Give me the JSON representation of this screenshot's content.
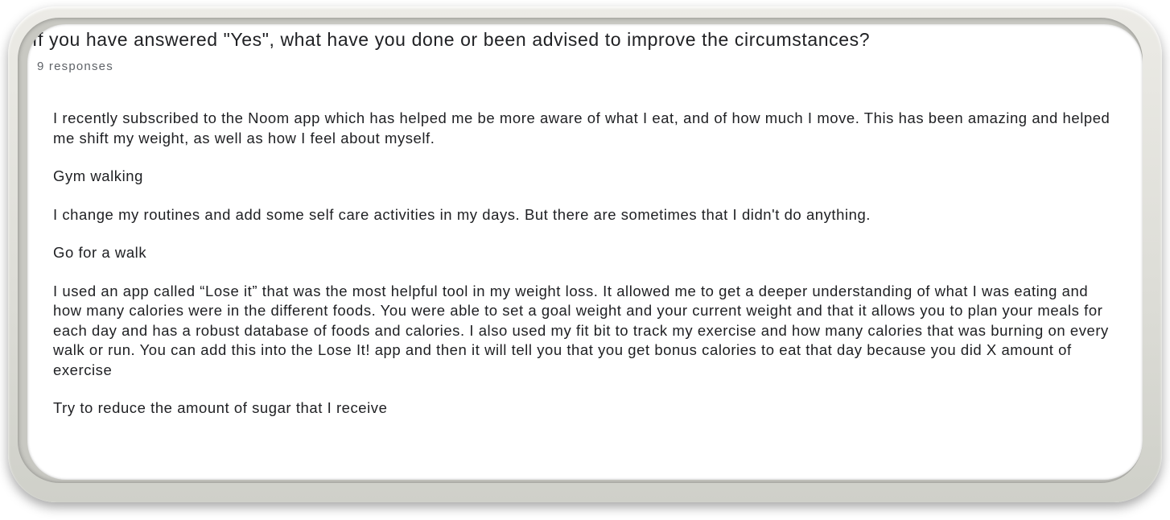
{
  "question": {
    "title": "If you have answered \"Yes\", what have you done or been advised to improve the circumstances?",
    "response_count": "9 responses"
  },
  "responses": [
    "I recently subscribed to the Noom app which has helped me be more aware of what I eat, and of how much I move. This has been amazing and helped me shift my weight, as well as how I feel about myself.",
    "Gym walking",
    "I change my routines and add some self care activities in my days. But there are sometimes that I didn't do anything.",
    "Go for a walk",
    "I used an app called “Lose it” that was the most helpful tool in my weight loss. It allowed me to get a deeper understanding of what I was eating and how many calories were in the different foods. You were able to set a goal weight and your current weight and that it allows you to plan your meals for each day and has a robust database of foods and calories. I also used my fit bit to track my exercise and how many calories that was burning on every walk or run. You can add this into the Lose It! app and then it will tell you that you get bonus calories to eat that day because you did X amount of exercise",
    "Try to reduce the amount of sugar that I receive"
  ]
}
